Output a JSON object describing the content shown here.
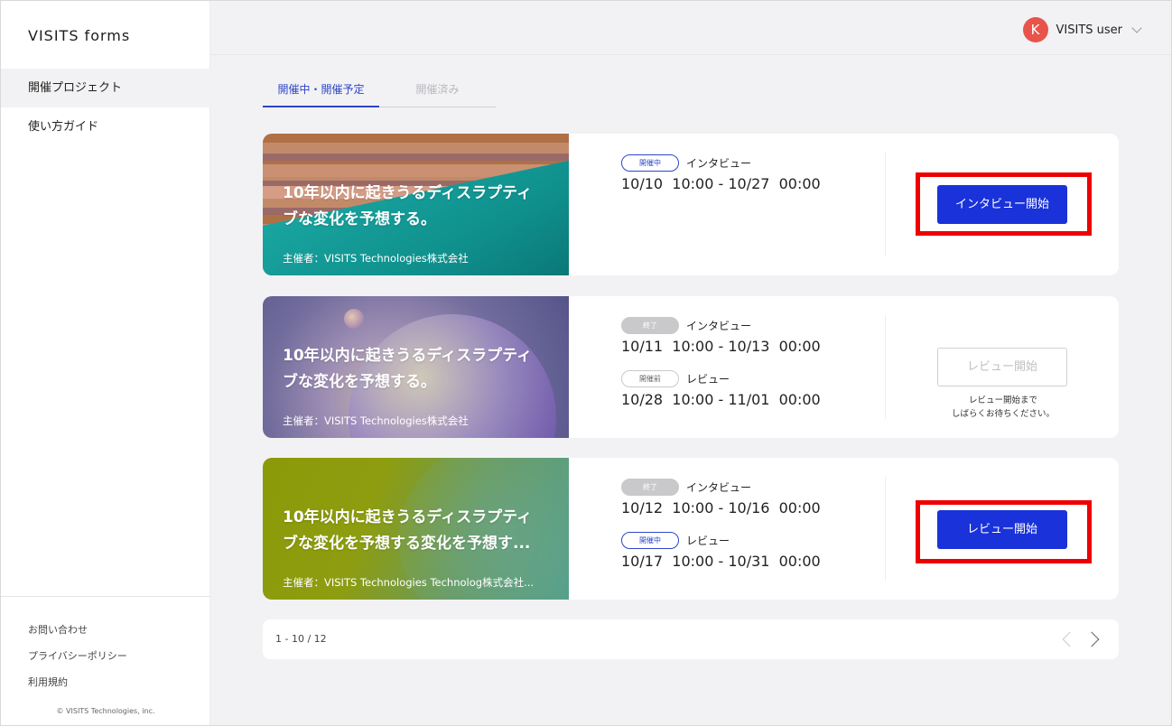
{
  "sidebar": {
    "logo": "VISITS forms",
    "nav": [
      "開催プロジェクト",
      "使い方ガイド"
    ],
    "footer_links": [
      "お問い合わせ",
      "プライバシーポリシー",
      "利用規約"
    ],
    "copyright": "© VISITS Technologies, inc."
  },
  "header": {
    "avatar_letter": "K",
    "user_name": "VISITS user"
  },
  "tabs": [
    "開催中・開催予定",
    "開催済み"
  ],
  "cards": [
    {
      "title_line1": "10年以内に起きうるディスラプティ",
      "title_line2": "ブな変化を予想する。",
      "organizer": "主催者：VISITS Technologies株式会社",
      "schedules": [
        {
          "status": "開催中",
          "type": "インタビュー",
          "period": "10/10  10:00 - 10/27  00:00"
        }
      ],
      "button": "インタビュー開始"
    },
    {
      "title_line1": "10年以内に起きうるディスラプティ",
      "title_line2": "ブな変化を予想する。",
      "organizer": "主催者：VISITS Technologies株式会社",
      "schedules": [
        {
          "status": "終了",
          "type": "インタビュー",
          "period": "10/11  10:00 - 10/13  00:00"
        },
        {
          "status": "開催前",
          "type": "レビュー",
          "period": "10/28  10:00 - 11/01  00:00"
        }
      ],
      "button": "レビュー開始",
      "note_line1": "レビュー開始まで",
      "note_line2": "しばらくお待ちください。"
    },
    {
      "title_line1": "10年以内に起きうるディスラプティ",
      "title_line2": "ブな変化を予想する変化を予想す...",
      "organizer": "主催者：VISITS Technologies Technolog株式会社...",
      "schedules": [
        {
          "status": "終了",
          "type": "インタビュー",
          "period": "10/12  10:00 - 10/16  00:00"
        },
        {
          "status": "開催中",
          "type": "レビュー",
          "period": "10/17  10:00 - 10/31  00:00"
        }
      ],
      "button": "レビュー開始"
    }
  ],
  "pagination": {
    "range_text": "1 - 10 / 12"
  },
  "colors": {
    "accent": "#1a32d9",
    "tab_active": "#2e45c8",
    "highlight": "#ee0000",
    "avatar": "#e8534a"
  }
}
